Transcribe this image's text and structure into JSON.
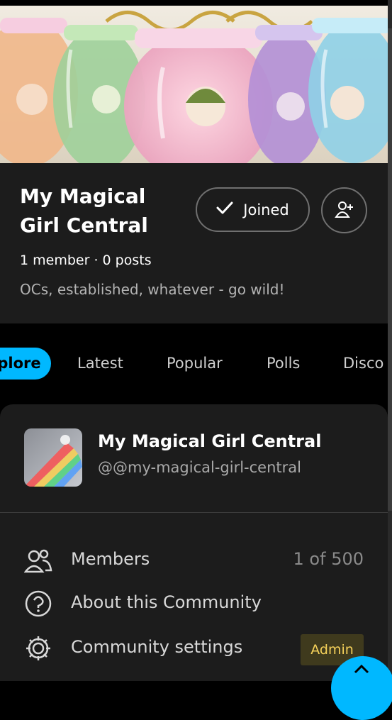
{
  "community": {
    "title": "My Magical Girl Central",
    "joined_label": "Joined",
    "member_count_text": "1 member",
    "separator": "·",
    "posts_text": "0 posts",
    "description": "OCs, established, whatever - go wild!"
  },
  "tabs": [
    "plore",
    "Latest",
    "Popular",
    "Polls",
    "Disco"
  ],
  "card": {
    "name": "My Magical Girl Central",
    "handle": "@@my-magical-girl-central"
  },
  "menu": {
    "members_label": "Members",
    "members_value": "1 of 500",
    "about_label": "About this Community",
    "settings_label": "Community settings",
    "admin_badge": "Admin"
  },
  "colors": {
    "accent": "#00b8ff",
    "background": "#000000",
    "panel": "#1c1c1c",
    "admin_badge_bg": "#3f3a1d",
    "admin_badge_text": "#f5d15a"
  }
}
